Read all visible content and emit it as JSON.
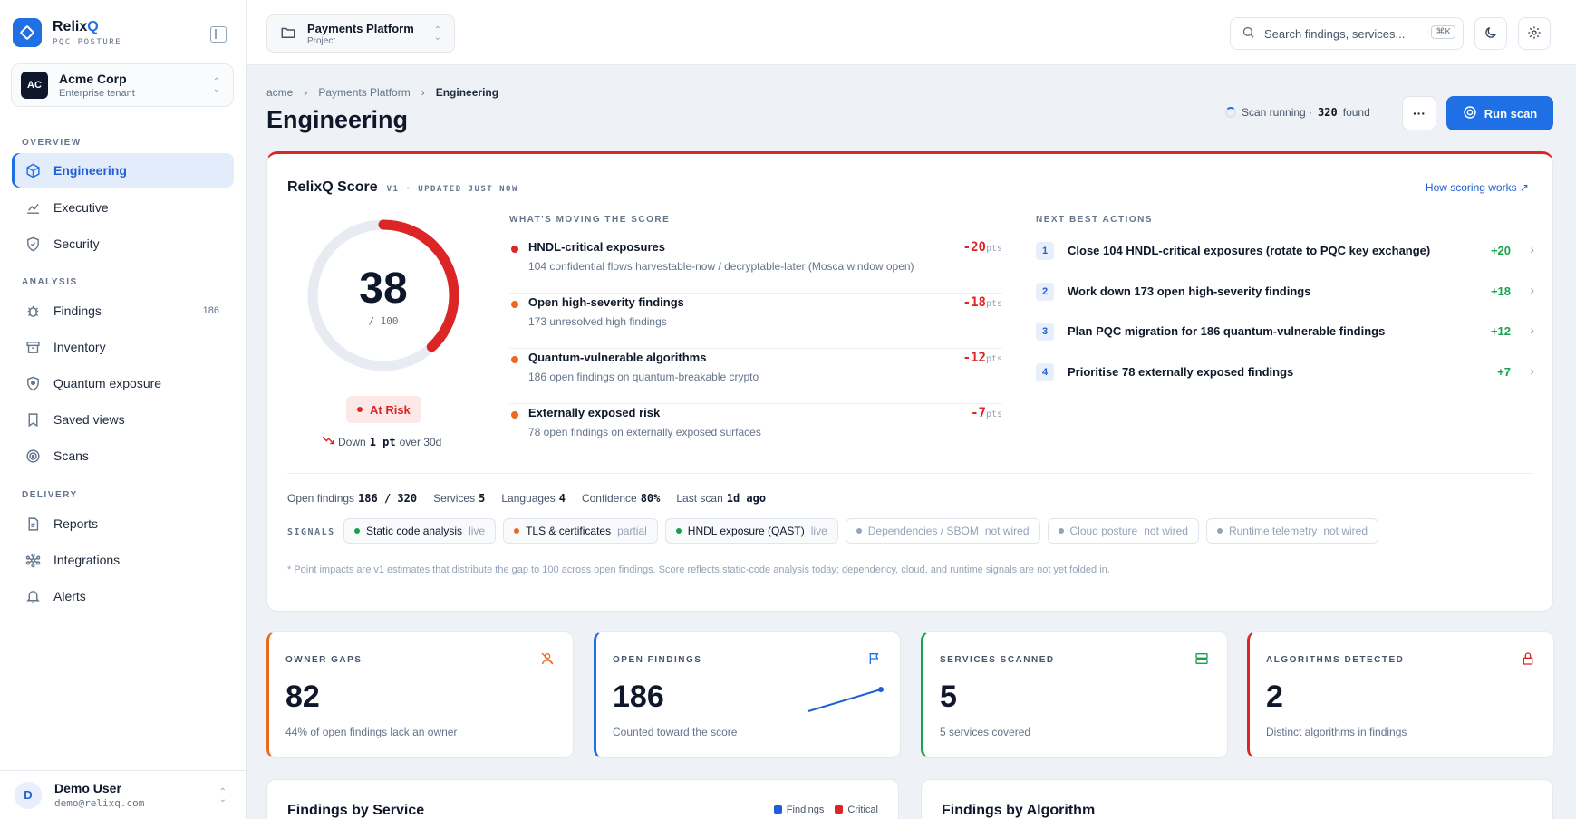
{
  "brand": {
    "name_a": "Relix",
    "name_b": "Q",
    "sub": "PQC POSTURE"
  },
  "tenant": {
    "initials": "AC",
    "name": "Acme Corp",
    "sub": "Enterprise tenant"
  },
  "nav": {
    "overview_h": "OVERVIEW",
    "analysis_h": "ANALYSIS",
    "delivery_h": "DELIVERY",
    "engineering": "Engineering",
    "executive": "Executive",
    "security": "Security",
    "findings": "Findings",
    "findings_count": "186",
    "inventory": "Inventory",
    "quantum": "Quantum exposure",
    "saved": "Saved views",
    "scans": "Scans",
    "reports": "Reports",
    "integrations": "Integrations",
    "alerts": "Alerts"
  },
  "user": {
    "initial": "D",
    "name": "Demo User",
    "email": "demo@relixq.com"
  },
  "topbar": {
    "project_name": "Payments Platform",
    "project_sub": "Project",
    "search_placeholder": "Search findings, services...",
    "search_kbd": "⌘K"
  },
  "breadcrumb": [
    "acme",
    "Payments Platform",
    "Engineering"
  ],
  "page_title": "Engineering",
  "scan": {
    "status": "Scan running ·",
    "count": "320",
    "found": "found",
    "run_label": "Run scan",
    "more": "···"
  },
  "score": {
    "title": "RelixQ Score",
    "meta": "V1 · UPDATED JUST NOW",
    "how_link": "How scoring works ↗",
    "value": "38",
    "value_num": 38,
    "max": "/ 100",
    "max_num": 100,
    "badge": "At Risk",
    "trend_a": "Down",
    "trend_b": "1 pt",
    "trend_c": "over 30d"
  },
  "moving_h": "WHAT'S MOVING THE SCORE",
  "movers": [
    {
      "title": "HNDL-critical exposures",
      "sub": "104 confidential flows harvestable-now / decryptable-later (Mosca window open)",
      "value": "-20",
      "unit": "pts",
      "color": "#dc2626"
    },
    {
      "title": "Open high-severity findings",
      "sub": "173 unresolved high findings",
      "value": "-18",
      "unit": "pts",
      "color": "#ea6a1f"
    },
    {
      "title": "Quantum-vulnerable algorithms",
      "sub": "186 open findings on quantum-breakable crypto",
      "value": "-12",
      "unit": "pts",
      "color": "#ea6a1f"
    },
    {
      "title": "Externally exposed risk",
      "sub": "78 open findings on externally exposed surfaces",
      "value": "-7",
      "unit": "pts",
      "color": "#ea6a1f"
    }
  ],
  "actions_h": "NEXT BEST ACTIONS",
  "actions": [
    {
      "n": "1",
      "title": "Close 104 HNDL-critical exposures (rotate to PQC key exchange)",
      "value": "+20"
    },
    {
      "n": "2",
      "title": "Work down 173 open high-severity findings",
      "value": "+18"
    },
    {
      "n": "3",
      "title": "Plan PQC migration for 186 quantum-vulnerable findings",
      "value": "+12"
    },
    {
      "n": "4",
      "title": "Prioritise 78 externally exposed findings",
      "value": "+7"
    }
  ],
  "stats": {
    "open_l": "Open findings",
    "open_v": "186 / 320",
    "services_l": "Services",
    "services_v": "5",
    "languages_l": "Languages",
    "languages_v": "4",
    "confidence_l": "Confidence",
    "confidence_v": "80%",
    "last_l": "Last scan",
    "last_v": "1d ago"
  },
  "signals_h": "SIGNALS",
  "signals": [
    {
      "label": "Static code analysis",
      "status": "live",
      "color": "#16a34a"
    },
    {
      "label": "TLS & certificates",
      "status": "partial",
      "color": "#ea6a1f"
    },
    {
      "label": "HNDL exposure (QAST)",
      "status": "live",
      "color": "#16a34a"
    },
    {
      "label": "Dependencies / SBOM",
      "status": "not wired",
      "color": "#94a3b8"
    },
    {
      "label": "Cloud posture",
      "status": "not wired",
      "color": "#94a3b8"
    },
    {
      "label": "Runtime telemetry",
      "status": "not wired",
      "color": "#94a3b8"
    }
  ],
  "footnote": "* Point impacts are v1 estimates that distribute the gap to 100 across open findings. Score reflects static-code analysis today; dependency, cloud, and runtime signals are not yet folded in.",
  "kpis": [
    {
      "title": "OWNER GAPS",
      "value": "82",
      "sub": "44% of open findings lack an owner",
      "accent": "#ea6a1f",
      "icon": "user-off-icon"
    },
    {
      "title": "OPEN FINDINGS",
      "value": "186",
      "sub": "Counted toward the score",
      "accent": "#1f6fe5",
      "icon": "flag-icon"
    },
    {
      "title": "SERVICES SCANNED",
      "value": "5",
      "sub": "5 services covered",
      "accent": "#16a34a",
      "icon": "server-icon"
    },
    {
      "title": "ALGORITHMS DETECTED",
      "value": "2",
      "sub": "Distinct algorithms in findings",
      "accent": "#dc2626",
      "icon": "lock-icon"
    }
  ],
  "bottom": {
    "service_title": "Findings by Service",
    "legend_findings": "Findings",
    "legend_critical": "Critical",
    "algo_title": "Findings by Algorithm"
  }
}
